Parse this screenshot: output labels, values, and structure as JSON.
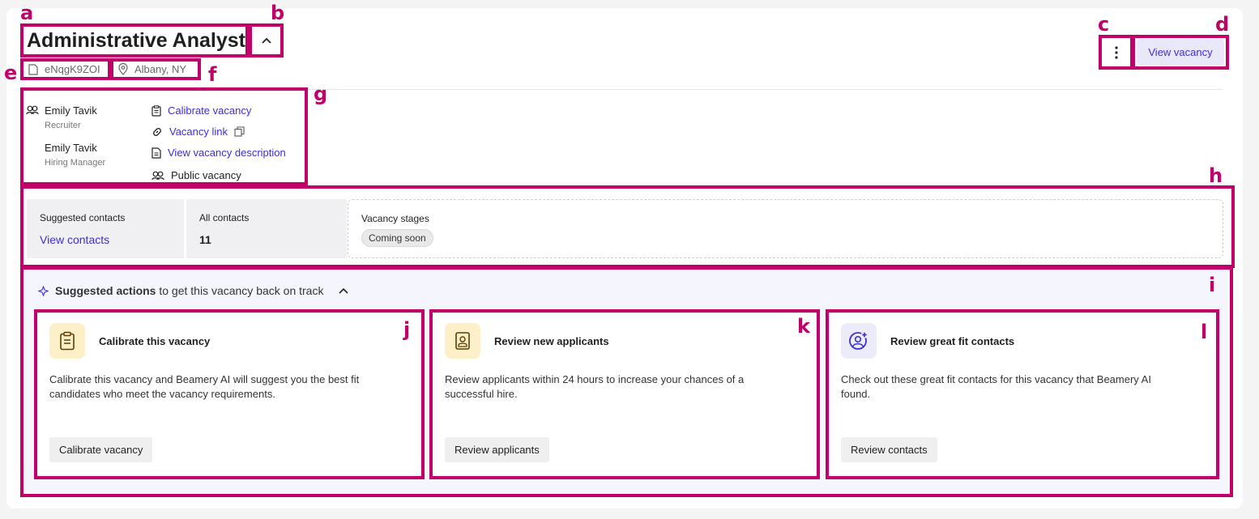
{
  "header": {
    "title": "Administrative Analyst",
    "vacancy_id": "eNqgK9ZOI",
    "location": "Albany, NY",
    "view_vacancy_label": "View vacancy"
  },
  "people": [
    {
      "name": "Emily Tavik",
      "role": "Recruiter"
    },
    {
      "name": "Emily Tavik",
      "role": "Hiring Manager"
    }
  ],
  "links": {
    "calibrate": "Calibrate vacancy",
    "vacancy_link": "Vacancy link",
    "description": "View vacancy description",
    "public": "Public vacancy"
  },
  "stats": {
    "suggested_contacts_label": "Suggested contacts",
    "suggested_contacts_link": "View contacts",
    "all_contacts_label": "All contacts",
    "all_contacts_value": "11",
    "stages_label": "Vacancy stages",
    "stages_badge": "Coming soon"
  },
  "suggested": {
    "bold": "Suggested actions",
    "rest": "to get this vacancy back on track",
    "cards": [
      {
        "title": "Calibrate this vacancy",
        "desc": "Calibrate this vacancy and Beamery AI will suggest you the best fit candidates who meet the vacancy requirements.",
        "button": "Calibrate vacancy"
      },
      {
        "title": "Review new applicants",
        "desc": "Review applicants within 24 hours to increase your chances of a successful hire.",
        "button": "Review applicants"
      },
      {
        "title": "Review great fit contacts",
        "desc": "Check out these great fit contacts for this vacancy that Beamery AI found.",
        "button": "Review contacts"
      }
    ]
  },
  "annotations": [
    "a",
    "b",
    "c",
    "d",
    "e",
    "f",
    "g",
    "h",
    "i",
    "j",
    "k",
    "l"
  ],
  "colors": {
    "accent": "#3e2fd6",
    "annotation": "#c2006a",
    "icon_bg_yellow": "#fdefc8",
    "icon_bg_purple": "#ecebfa"
  }
}
